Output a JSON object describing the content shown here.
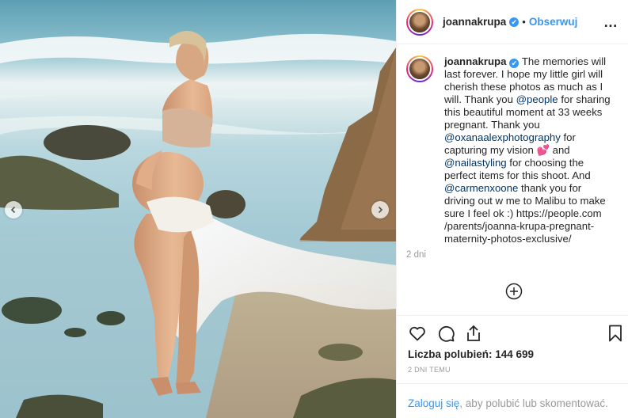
{
  "post": {
    "username": "joannakrupa",
    "verified_badge": "✔",
    "separator": "•",
    "follow_label": "Obserwuj",
    "more_icon": "…"
  },
  "caption": {
    "username": "joannakrupa",
    "text_1": " The memories will last forever. I hope my little girl will cherish these photos as much as I will. Thank you ",
    "mention_1": "@people",
    "text_2": " for sharing this beautiful moment at 33 weeks pregnant. Thank you ",
    "mention_2": "@oxanaalexphotography",
    "text_3": " for capturing my vision ",
    "emoji": "💕",
    "text_4": " and ",
    "mention_3": "@nailastyling",
    "text_5": " for choosing the perfect items for this shoot. And ",
    "mention_4": "@carmenxoone",
    "text_6": " thank you for driving out w me to Malibu to make sure I feel ok :) https://people.com /parents/joanna-krupa-pregnant-maternity-photos-exclusive/",
    "time": "2 dni"
  },
  "likes": {
    "label": "Liczba polubień: 144 699"
  },
  "posted_ago": "2 DNI TEMU",
  "login_prompt": {
    "link": "Zaloguj się",
    "text": ", aby polubić lub skomentować."
  },
  "icons": {
    "prev": "chevron-left-icon",
    "next": "chevron-right-icon",
    "like": "heart-icon",
    "comment": "comment-icon",
    "share": "share-icon",
    "save": "bookmark-icon",
    "load_more": "plus-circle-icon"
  },
  "colors": {
    "link_blue": "#3897f0",
    "mention": "#003569",
    "muted": "#999999",
    "border": "#efefef"
  }
}
